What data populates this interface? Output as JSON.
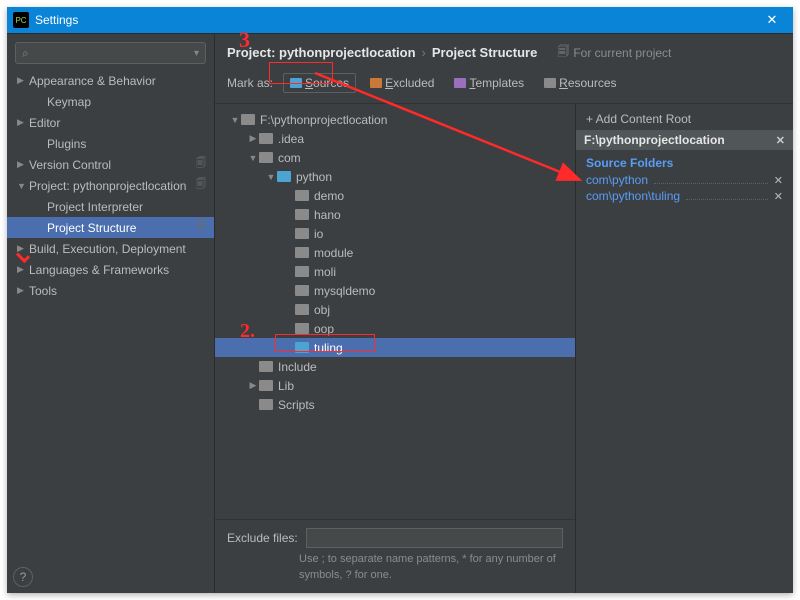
{
  "title": "Settings",
  "search_placeholder": "",
  "nav": [
    {
      "label": "Appearance & Behavior",
      "chev": "▶",
      "indent": false,
      "copy": false
    },
    {
      "label": "Keymap",
      "chev": "",
      "indent": true,
      "copy": false
    },
    {
      "label": "Editor",
      "chev": "▶",
      "indent": false,
      "copy": false
    },
    {
      "label": "Plugins",
      "chev": "",
      "indent": true,
      "copy": false
    },
    {
      "label": "Version Control",
      "chev": "▶",
      "indent": false,
      "copy": true
    },
    {
      "label": "Project: pythonprojectlocation",
      "chev": "▼",
      "indent": false,
      "copy": true
    },
    {
      "label": "Project Interpreter",
      "chev": "",
      "indent": true,
      "copy": false
    },
    {
      "label": "Project Structure",
      "chev": "",
      "indent": true,
      "copy": true,
      "selected": true
    },
    {
      "label": "Build, Execution, Deployment",
      "chev": "▶",
      "indent": false,
      "copy": false
    },
    {
      "label": "Languages & Frameworks",
      "chev": "▶",
      "indent": false,
      "copy": false
    },
    {
      "label": "Tools",
      "chev": "▶",
      "indent": false,
      "copy": false
    }
  ],
  "breadcrumb": {
    "first": "Project: pythonprojectlocation",
    "sep": "›",
    "second": "Project Structure",
    "for_label": "For current project"
  },
  "markas": {
    "label": "Mark as:",
    "sources": "Sources",
    "excluded": "Excluded",
    "templates": "Templates",
    "resources": "Resources"
  },
  "tree": [
    {
      "depth": 0,
      "chev": "▼",
      "icon": "grey",
      "label": "F:\\pythonprojectlocation"
    },
    {
      "depth": 1,
      "chev": "▶",
      "icon": "grey",
      "label": ".idea"
    },
    {
      "depth": 1,
      "chev": "▼",
      "icon": "grey",
      "label": "com"
    },
    {
      "depth": 2,
      "chev": "▼",
      "icon": "blue",
      "label": "python"
    },
    {
      "depth": 3,
      "chev": "",
      "icon": "grey",
      "label": "demo"
    },
    {
      "depth": 3,
      "chev": "",
      "icon": "grey",
      "label": "hano"
    },
    {
      "depth": 3,
      "chev": "",
      "icon": "grey",
      "label": "io"
    },
    {
      "depth": 3,
      "chev": "",
      "icon": "grey",
      "label": "module"
    },
    {
      "depth": 3,
      "chev": "",
      "icon": "grey",
      "label": "moli"
    },
    {
      "depth": 3,
      "chev": "",
      "icon": "grey",
      "label": "mysqldemo"
    },
    {
      "depth": 3,
      "chev": "",
      "icon": "grey",
      "label": "obj"
    },
    {
      "depth": 3,
      "chev": "",
      "icon": "grey",
      "label": "oop"
    },
    {
      "depth": 3,
      "chev": "",
      "icon": "blue",
      "label": "tuling",
      "selected": true
    },
    {
      "depth": 1,
      "chev": "",
      "icon": "grey",
      "label": "Include"
    },
    {
      "depth": 1,
      "chev": "▶",
      "icon": "grey",
      "label": "Lib"
    },
    {
      "depth": 1,
      "chev": "",
      "icon": "grey",
      "label": "Scripts"
    }
  ],
  "exclude": {
    "label": "Exclude files:",
    "hint": "Use ; to separate name patterns, * for any number of symbols, ? for one."
  },
  "roots": {
    "add_label": "+ Add Content Root",
    "root": "F:\\pythonprojectlocation",
    "section": "Source Folders",
    "items": [
      "com\\python",
      "com\\python\\tuling"
    ]
  },
  "annotations": {
    "step2": "2.",
    "step3": "3"
  }
}
